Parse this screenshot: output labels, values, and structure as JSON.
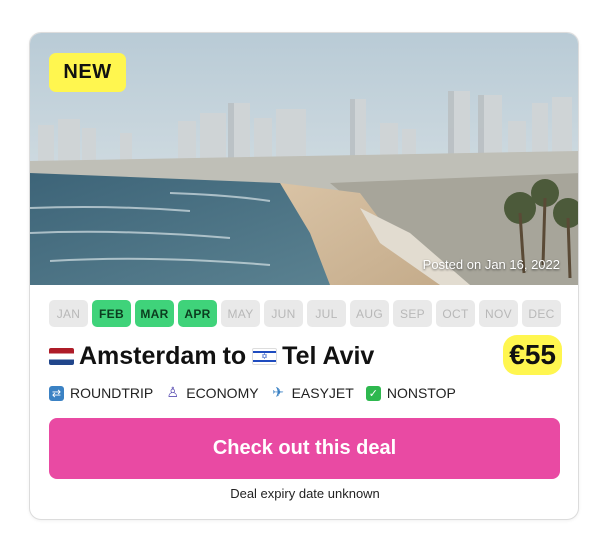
{
  "badge": {
    "label": "NEW"
  },
  "photo": {
    "posted": "Posted on Jan 16, 2022"
  },
  "months": [
    {
      "label": "JAN",
      "active": false
    },
    {
      "label": "FEB",
      "active": true
    },
    {
      "label": "MAR",
      "active": true
    },
    {
      "label": "APR",
      "active": true
    },
    {
      "label": "MAY",
      "active": false
    },
    {
      "label": "JUN",
      "active": false
    },
    {
      "label": "JUL",
      "active": false
    },
    {
      "label": "AUG",
      "active": false
    },
    {
      "label": "SEP",
      "active": false
    },
    {
      "label": "OCT",
      "active": false
    },
    {
      "label": "NOV",
      "active": false
    },
    {
      "label": "DEC",
      "active": false
    }
  ],
  "route": {
    "origin": "Amsterdam",
    "connector": "to",
    "destination": "Tel Aviv",
    "origin_flag": "netherlands-flag-icon",
    "destination_flag": "israel-flag-icon"
  },
  "price": "€55",
  "tags": [
    {
      "icon": "roundtrip-icon",
      "label": "ROUNDTRIP"
    },
    {
      "icon": "seat-icon",
      "label": "ECONOMY"
    },
    {
      "icon": "airplane-icon",
      "label": "EASYJET"
    },
    {
      "icon": "checkmark-icon",
      "label": "NONSTOP"
    }
  ],
  "cta": {
    "label": "Check out this deal"
  },
  "expiry": "Deal expiry date unknown",
  "colors": {
    "badge_yellow": "#fff64f",
    "month_active": "#3fd37a",
    "month_inactive": "#e9e9e9",
    "cta_pink": "#e94aa3"
  }
}
